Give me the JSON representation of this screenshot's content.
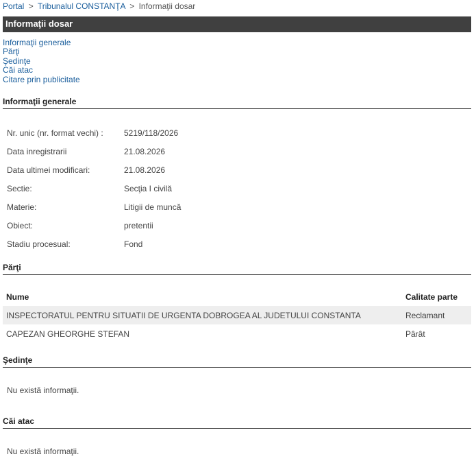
{
  "breadcrumb": {
    "portal": "Portal",
    "tribunal": "Tribunalul CONSTANŢA",
    "current": "Informaţii dosar",
    "sep": ">"
  },
  "title": "Informaţii dosar",
  "nav": [
    "Informaţii generale",
    "Părţi",
    "Şedinţe",
    "Căi atac",
    "Citare prin publicitate"
  ],
  "general": {
    "heading": "Informaţii generale",
    "rows": [
      {
        "label": "Nr. unic (nr. format vechi) :",
        "value": "5219/118/2026"
      },
      {
        "label": "Data inregistrarii",
        "value": "21.08.2026"
      },
      {
        "label": "Data ultimei modificari:",
        "value": "21.08.2026"
      },
      {
        "label": "Sectie:",
        "value": "Secţia I civilă"
      },
      {
        "label": "Materie:",
        "value": "Litigii de muncă"
      },
      {
        "label": "Obiect:",
        "value": "pretentii"
      },
      {
        "label": "Stadiu procesual:",
        "value": "Fond"
      }
    ]
  },
  "parti": {
    "heading": "Părţi",
    "col_name": "Nume",
    "col_role": "Calitate parte",
    "rows": [
      {
        "name": "INSPECTORATUL PENTRU SITUATII DE URGENTA DOBROGEA AL JUDETULUI CONSTANTA",
        "role": "Reclamant"
      },
      {
        "name": "CAPEZAN GHEORGHE STEFAN",
        "role": "Pârât"
      }
    ]
  },
  "sedinte": {
    "heading": "Şedinţe",
    "empty": "Nu există informaţii."
  },
  "cai_atac": {
    "heading": "Căi atac",
    "empty": "Nu există informaţii."
  }
}
